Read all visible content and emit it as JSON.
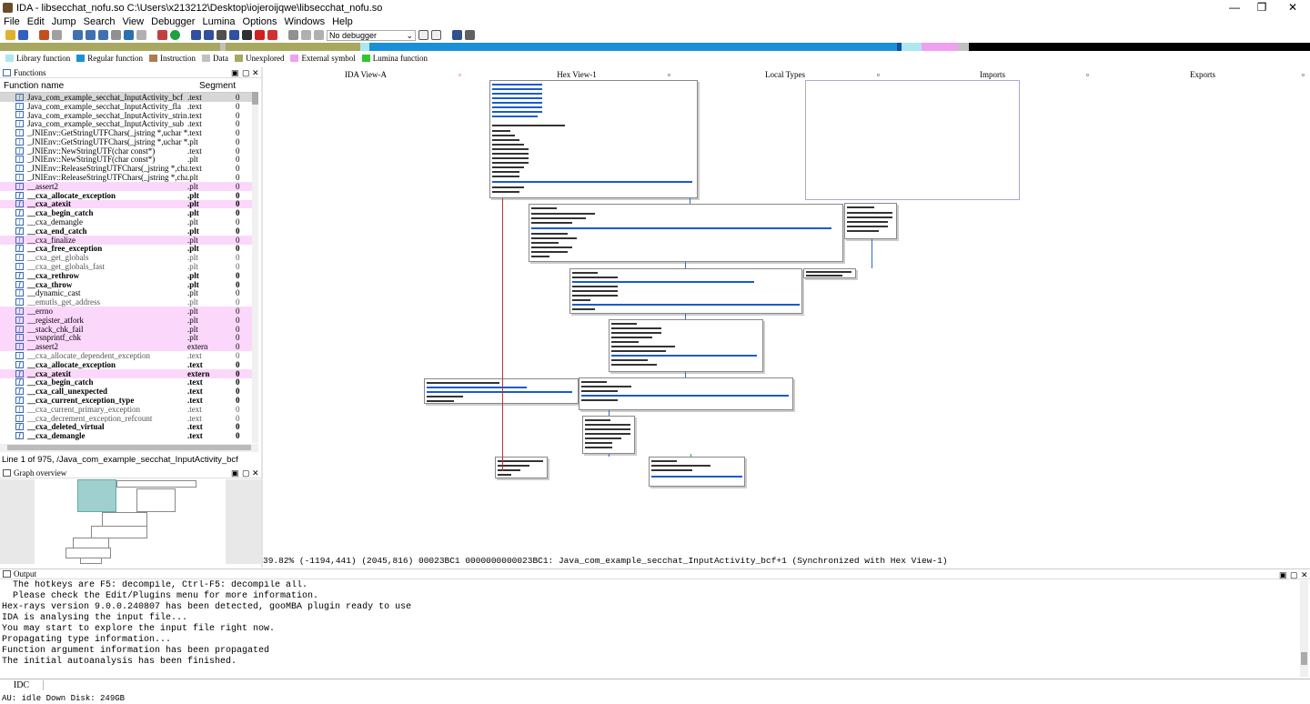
{
  "window": {
    "title": "IDA - libsecchat_nofu.so C:\\Users\\x213212\\Desktop\\iojeroijqwe\\libsecchat_nofu.so",
    "minimize": "—",
    "maximize": "❐",
    "close": "✕"
  },
  "menu": [
    "File",
    "Edit",
    "Jump",
    "Search",
    "View",
    "Debugger",
    "Lumina",
    "Options",
    "Windows",
    "Help"
  ],
  "toolbar": {
    "debugger_select": "No debugger"
  },
  "legend": [
    {
      "label": "Library function",
      "color": "#aee7f0"
    },
    {
      "label": "Regular function",
      "color": "#1a90d8"
    },
    {
      "label": "Instruction",
      "color": "#b07a50"
    },
    {
      "label": "Data",
      "color": "#c0c0c0"
    },
    {
      "label": "Unexplored",
      "color": "#a8a860"
    },
    {
      "label": "External symbol",
      "color": "#f0a0f0"
    },
    {
      "label": "Lumina function",
      "color": "#2ec82e"
    }
  ],
  "functions_panel": {
    "title": "Functions",
    "col_name": "Function name",
    "col_segment": "Segment",
    "status": "Line 1 of 975, /Java_com_example_secchat_InputActivity_bcf"
  },
  "functions": [
    {
      "name": "Java_com_example_secchat_InputActivity_bcf",
      "seg": ".text",
      "st": "0",
      "cls": "sel"
    },
    {
      "name": "Java_com_example_secchat_InputActivity_fla",
      "seg": ".text",
      "st": "0",
      "cls": ""
    },
    {
      "name": "Java_com_example_secchat_InputActivity_stringF...",
      "seg": ".text",
      "st": "0",
      "cls": ""
    },
    {
      "name": "Java_com_example_secchat_InputActivity_sub",
      "seg": ".text",
      "st": "0",
      "cls": ""
    },
    {
      "name": "_JNIEnv::GetStringUTFChars(_jstring *,uchar *)",
      "seg": ".text",
      "st": "0",
      "cls": ""
    },
    {
      "name": "_JNIEnv::GetStringUTFChars(_jstring *,uchar *)",
      "seg": ".plt",
      "st": "0",
      "cls": ""
    },
    {
      "name": "_JNIEnv::NewStringUTF(char const*)",
      "seg": ".text",
      "st": "0",
      "cls": ""
    },
    {
      "name": "_JNIEnv::NewStringUTF(char const*)",
      "seg": ".plt",
      "st": "0",
      "cls": ""
    },
    {
      "name": "_JNIEnv::ReleaseStringUTFChars(_jstring *,char ...",
      "seg": ".text",
      "st": "0",
      "cls": ""
    },
    {
      "name": "_JNIEnv::ReleaseStringUTFChars(_jstring *,char ...",
      "seg": ".plt",
      "st": "0",
      "cls": ""
    },
    {
      "name": "__assert2",
      "seg": ".plt",
      "st": "0",
      "cls": "imp"
    },
    {
      "name": "__cxa_allocate_exception",
      "seg": ".plt",
      "st": "0",
      "cls": "bold"
    },
    {
      "name": "__cxa_atexit",
      "seg": ".plt",
      "st": "0",
      "cls": "imp bold"
    },
    {
      "name": "__cxa_begin_catch",
      "seg": ".plt",
      "st": "0",
      "cls": "bold"
    },
    {
      "name": "__cxa_demangle",
      "seg": ".plt",
      "st": "0",
      "cls": ""
    },
    {
      "name": "__cxa_end_catch",
      "seg": ".plt",
      "st": "0",
      "cls": "bold"
    },
    {
      "name": "__cxa_finalize",
      "seg": ".plt",
      "st": "0",
      "cls": "imp"
    },
    {
      "name": "__cxa_free_exception",
      "seg": ".plt",
      "st": "0",
      "cls": "bold"
    },
    {
      "name": "__cxa_get_globals",
      "seg": ".plt",
      "st": "0",
      "cls": "lib"
    },
    {
      "name": "__cxa_get_globals_fast",
      "seg": ".plt",
      "st": "0",
      "cls": "lib"
    },
    {
      "name": "__cxa_rethrow",
      "seg": ".plt",
      "st": "0",
      "cls": "bold"
    },
    {
      "name": "__cxa_throw",
      "seg": ".plt",
      "st": "0",
      "cls": "bold"
    },
    {
      "name": "__dynamic_cast",
      "seg": ".plt",
      "st": "0",
      "cls": ""
    },
    {
      "name": "__emutls_get_address",
      "seg": ".plt",
      "st": "0",
      "cls": "lib"
    },
    {
      "name": "__errno",
      "seg": ".plt",
      "st": "0",
      "cls": "imp"
    },
    {
      "name": "__register_atfork",
      "seg": ".plt",
      "st": "0",
      "cls": "imp"
    },
    {
      "name": "__stack_chk_fail",
      "seg": ".plt",
      "st": "0",
      "cls": "imp"
    },
    {
      "name": "__vsnprintf_chk",
      "seg": ".plt",
      "st": "0",
      "cls": "imp"
    },
    {
      "name": "__assert2",
      "seg": "extern",
      "st": "0",
      "cls": "imp"
    },
    {
      "name": "__cxa_allocate_dependent_exception",
      "seg": ".text",
      "st": "0",
      "cls": "lib"
    },
    {
      "name": "__cxa_allocate_exception",
      "seg": ".text",
      "st": "0",
      "cls": "bold"
    },
    {
      "name": "__cxa_atexit",
      "seg": "extern",
      "st": "0",
      "cls": "imp bold"
    },
    {
      "name": "__cxa_begin_catch",
      "seg": ".text",
      "st": "0",
      "cls": "bold"
    },
    {
      "name": "__cxa_call_unexpected",
      "seg": ".text",
      "st": "0",
      "cls": "bold"
    },
    {
      "name": "__cxa_current_exception_type",
      "seg": ".text",
      "st": "0",
      "cls": "bold"
    },
    {
      "name": "__cxa_current_primary_exception",
      "seg": ".text",
      "st": "0",
      "cls": "lib"
    },
    {
      "name": "__cxa_decrement_exception_refcount",
      "seg": ".text",
      "st": "0",
      "cls": "lib"
    },
    {
      "name": "__cxa_deleted_virtual",
      "seg": ".text",
      "st": "0",
      "cls": "bold"
    },
    {
      "name": "__cxa_demangle",
      "seg": ".text",
      "st": "0",
      "cls": "bold"
    }
  ],
  "graph_overview": {
    "title": "Graph overview"
  },
  "tabs": {
    "ida_view": "IDA View-A",
    "hex_view": "Hex View-1",
    "local_types": "Local Types",
    "imports": "Imports",
    "exports": "Exports"
  },
  "graph_status": "39.82% (-1194,441) (2045,816) 00023BC1 0000000000023BC1: Java_com_example_secchat_InputActivity_bcf+1 (Synchronized with Hex View-1)",
  "output": {
    "title": "Output",
    "lines": [
      "  The hotkeys are F5: decompile, Ctrl-F5: decompile all.",
      "",
      "  Please check the Edit/Plugins menu for more information.",
      "Hex-rays version 9.0.0.240807 has been detected, gooMBA plugin ready to use",
      "IDA is analysing the input file...",
      "You may start to explore the input file right now.",
      "Propagating type information...",
      "Function argument information has been propagated",
      "The initial autoanalysis has been finished."
    ]
  },
  "idc_label": "IDC",
  "statusbar": "AU:  idle   Down  Disk: 249GB"
}
